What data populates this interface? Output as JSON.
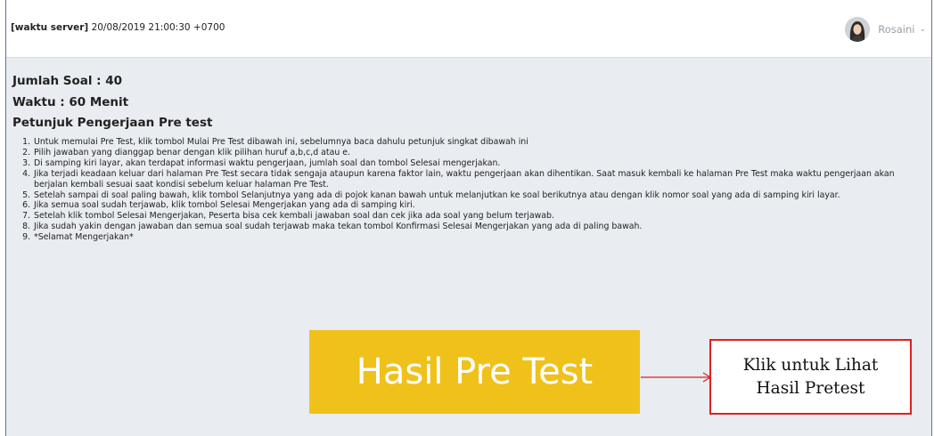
{
  "header": {
    "server_time_label": "[waktu server]",
    "server_time_value": "20/08/2019 21:00:30 +0700",
    "user_name": "Rosaini",
    "user_menu_icon": "chevron-down-icon",
    "avatar_icon": "user-avatar"
  },
  "exam": {
    "question_count": "Jumlah Soal : 40",
    "duration": "Waktu : 60 Menit",
    "instructions_title": "Petunjuk Pengerjaan Pre test",
    "instructions": [
      "Untuk memulai Pre Test, klik tombol Mulai Pre Test dibawah ini, sebelumnya baca dahulu petunjuk singkat dibawah ini",
      "Pilih jawaban yang dianggap benar dengan klik pilihan huruf a,b,c,d atau e.",
      "Di samping kiri layar, akan terdapat informasi waktu pengerjaan, jumlah soal dan tombol Selesai mengerjakan.",
      "Jika terjadi keadaan keluar dari halaman Pre Test secara tidak sengaja ataupun karena faktor lain, waktu pengerjaan akan dihentikan. Saat masuk kembali ke halaman Pre Test maka waktu pengerjaan akan berjalan kembali sesuai saat kondisi sebelum keluar halaman Pre Test.",
      "Setelah sampai di soal paling bawah, klik tombol Selanjutnya yang ada di pojok kanan bawah untuk melanjutkan ke soal berikutnya atau dengan klik nomor soal yang ada di samping kiri layar.",
      "Jika semua soal sudah terjawab, klik tombol Selesai Mengerjakan yang ada di samping kiri.",
      "Setelah klik tombol Selesai Mengerjakan, Peserta bisa cek kembali jawaban soal dan cek jika ada soal yang belum terjawab.",
      "Jika sudah yakin dengan jawaban dan semua soal sudah terjawab maka tekan tombol Konfirmasi Selesai Mengerjakan yang ada di paling bawah.",
      "*Selamat Mengerjakan*"
    ],
    "result_button_label": "Hasil Pre Test"
  },
  "callout": {
    "line1": "Klik untuk Lihat",
    "line2": "Hasil Pretest"
  },
  "colors": {
    "result_button_bg": "#f0c11a",
    "callout_border": "#e02020",
    "page_bg": "#e9ecf1"
  }
}
